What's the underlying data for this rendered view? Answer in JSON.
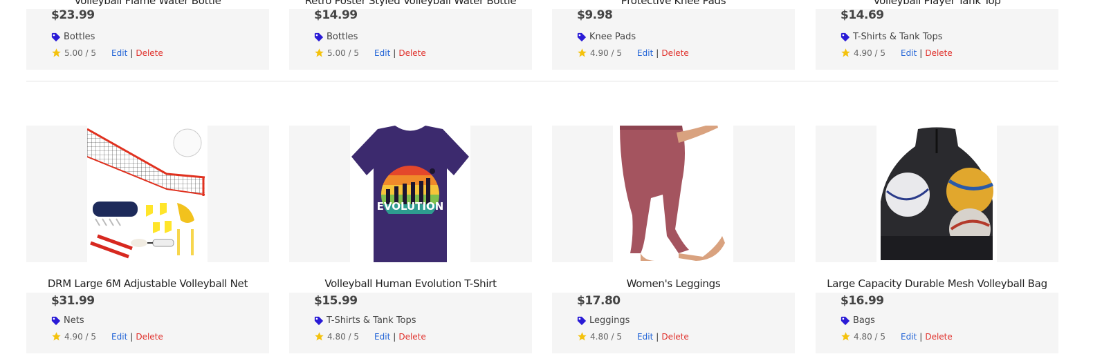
{
  "top_row": [
    {
      "title": "Volleyball Flame Water Bottle",
      "price": "$23.99",
      "category": "Bottles",
      "rating": "5.00 / 5",
      "edit_label": "Edit",
      "separator": "|",
      "delete_label": "Delete"
    },
    {
      "title": "Retro Poster Styled Volleyball Water Bottle",
      "price": "$14.99",
      "category": "Bottles",
      "rating": "5.00 / 5",
      "edit_label": "Edit",
      "separator": "|",
      "delete_label": "Delete"
    },
    {
      "title": "Protective Knee Pads",
      "price": "$9.98",
      "category": "Knee Pads",
      "rating": "4.90 / 5",
      "edit_label": "Edit",
      "separator": "|",
      "delete_label": "Delete"
    },
    {
      "title": "Volleyball Player Tank Top",
      "price": "$14.69",
      "category": "T-Shirts & Tank Tops",
      "rating": "4.90 / 5",
      "edit_label": "Edit",
      "separator": "|",
      "delete_label": "Delete"
    }
  ],
  "bottom_row": [
    {
      "title": "DRM Large 6M Adjustable Volleyball Net",
      "price": "$31.99",
      "category": "Nets",
      "rating": "4.90 / 5",
      "edit_label": "Edit",
      "separator": "|",
      "delete_label": "Delete",
      "image": "volleyball-net-set-image"
    },
    {
      "title": "Volleyball Human Evolution T-Shirt",
      "price": "$15.99",
      "category": "T-Shirts & Tank Tops",
      "rating": "4.80 / 5",
      "edit_label": "Edit",
      "separator": "|",
      "delete_label": "Delete",
      "image": "evolution-tshirt-image",
      "image_text": "EVOLUTION"
    },
    {
      "title": "Women's Leggings",
      "price": "$17.80",
      "category": "Leggings",
      "rating": "4.80 / 5",
      "edit_label": "Edit",
      "separator": "|",
      "delete_label": "Delete",
      "image": "leggings-image"
    },
    {
      "title": "Large Capacity Durable Mesh Volleyball Bag",
      "price": "$16.99",
      "category": "Bags",
      "rating": "4.80 / 5",
      "edit_label": "Edit",
      "separator": "|",
      "delete_label": "Delete",
      "image": "mesh-bag-image"
    }
  ],
  "colors": {
    "tag_icon": "#2a1bd6",
    "star_icon": "#f4c20d",
    "edit_link": "#1f62d6",
    "delete_link": "#e0302b",
    "card_background": "#f5f5f5"
  },
  "icons": {
    "category": "tag-icon",
    "rating": "star-icon"
  }
}
